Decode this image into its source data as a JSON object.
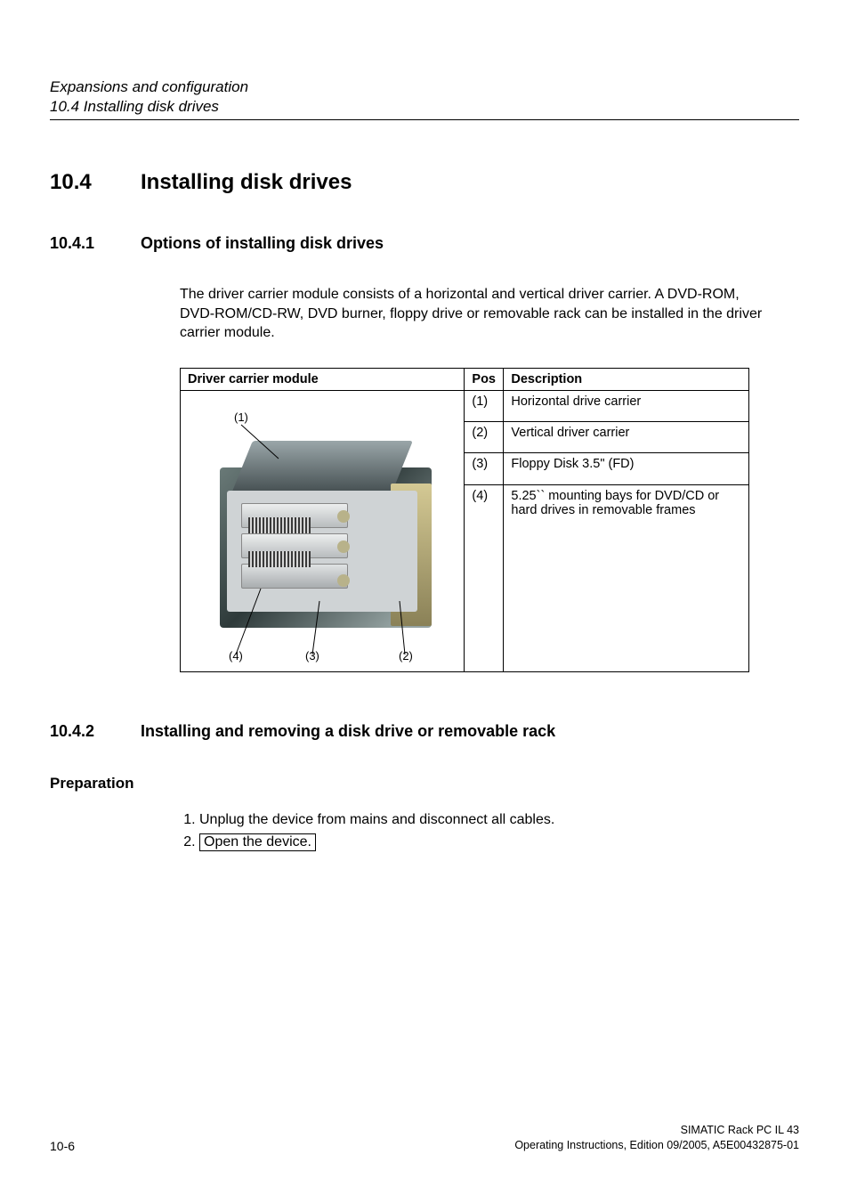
{
  "running_head": {
    "chapter": "Expansions and configuration",
    "section": "10.4 Installing disk drives"
  },
  "h2": {
    "num": "10.4",
    "title": "Installing disk drives"
  },
  "h3a": {
    "num": "10.4.1",
    "title": "Options of installing disk drives"
  },
  "para1": "The driver carrier module consists of a horizontal and vertical driver carrier. A DVD-ROM, DVD-ROM/CD-RW, DVD burner, floppy drive or removable rack can be installed in the driver carrier module.",
  "table": {
    "head": {
      "module": "Driver carrier module",
      "pos": "Pos",
      "desc": "Description"
    },
    "rows": [
      {
        "pos": "(1)",
        "desc": "Horizontal drive carrier"
      },
      {
        "pos": "(2)",
        "desc": "Vertical driver carrier"
      },
      {
        "pos": "(3)",
        "desc": "Floppy Disk 3.5\" (FD)"
      },
      {
        "pos": "(4)",
        "desc": "5.25`` mounting bays for DVD/CD or hard drives in removable frames"
      }
    ],
    "labels": {
      "l1": "(1)",
      "l2": "(2)",
      "l3": "(3)",
      "l4": "(4)"
    }
  },
  "h3b": {
    "num": "10.4.2",
    "title": "Installing and removing a disk drive or removable rack"
  },
  "h4_prep": "Preparation",
  "steps": {
    "s1": "Unplug the device from mains and disconnect all cables.",
    "s2": "Open the device."
  },
  "footer": {
    "page": "10-6",
    "product": "SIMATIC Rack PC IL 43",
    "doc": "Operating Instructions, Edition 09/2005, A5E00432875-01"
  }
}
